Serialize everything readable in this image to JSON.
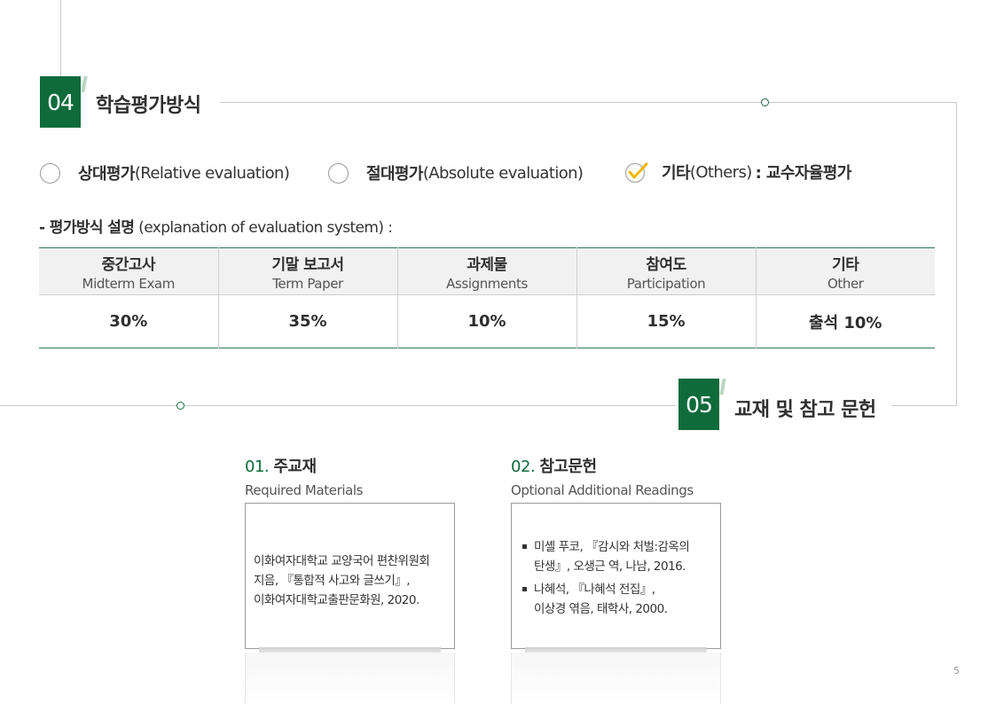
{
  "section4": {
    "number": "04",
    "title": "학습평가방식",
    "options": [
      {
        "label_ko": "상대평가",
        "label_en": "(Relative evaluation)",
        "checked": false
      },
      {
        "label_ko": "절대평가",
        "label_en": "(Absolute evaluation)",
        "checked": false
      },
      {
        "label_ko": "기타",
        "label_en": "(Others)",
        "suffix": ": 교수자율평가",
        "checked": true
      }
    ],
    "explain_ko": "- 평가방식 설명",
    "explain_en": "(explanation of evaluation system) :",
    "table": {
      "headers": [
        {
          "ko": "중간고사",
          "en": "Midterm Exam"
        },
        {
          "ko": "기말 보고서",
          "en": "Term Paper"
        },
        {
          "ko": "과제물",
          "en": "Assignments"
        },
        {
          "ko": "참여도",
          "en": "Participation"
        },
        {
          "ko": "기타",
          "en": "Other"
        }
      ],
      "values": [
        "30%",
        "35%",
        "10%",
        "15%",
        "출석 10%"
      ]
    }
  },
  "section5": {
    "number": "05",
    "title": "교재 및 참고 문헌",
    "required": {
      "num": "01.",
      "title": "주교재",
      "subtitle": "Required Materials",
      "lines": [
        "이화여자대학교 교양국어 편찬위원회",
        "지음, 『통합적 사고와 글쓰기』,",
        "이화여자대학교출판문화원, 2020."
      ]
    },
    "optional": {
      "num": "02.",
      "title": "참고문헌",
      "subtitle": "Optional Additional Readings",
      "items": [
        [
          "미셸 푸코, 『감시와 처벌:감옥의",
          "탄생』, 오생근 역, 나남, 2016."
        ],
        [
          "나혜석, 『나혜석 전집』,",
          "이상경 엮음, 태학사, 2000."
        ]
      ]
    }
  },
  "page_number": "5",
  "colors": {
    "accent": "#0f6b3b",
    "check": "#f2b705"
  }
}
